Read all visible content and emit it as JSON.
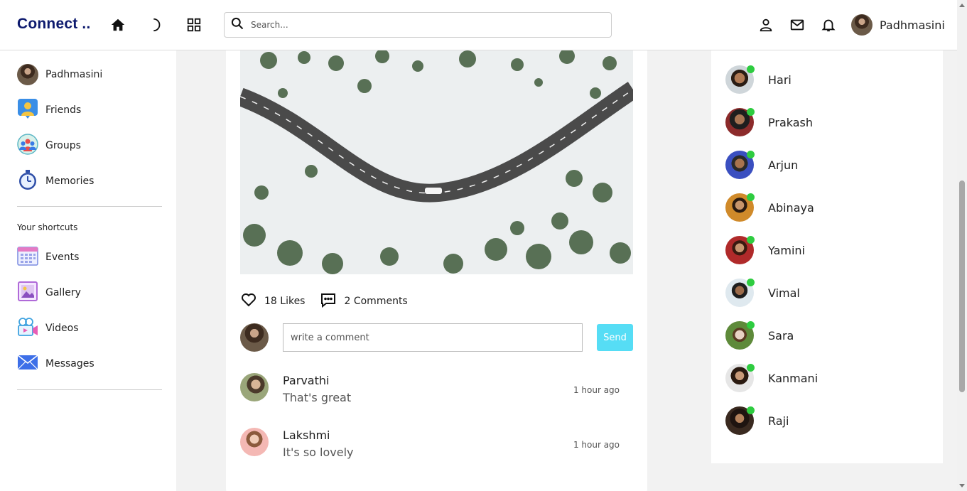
{
  "app": {
    "title": "Connect .."
  },
  "navbar": {
    "icons": [
      "home-icon",
      "moon-icon",
      "grid-icon"
    ],
    "search_placeholder": "Search...",
    "right_icons": [
      "person-icon",
      "mail-icon",
      "bell-icon"
    ],
    "user_name": "Padhmasini"
  },
  "sidebar": {
    "items": [
      {
        "label": "Padhmasini",
        "icon": "avatar"
      },
      {
        "label": "Friends",
        "icon": "friends-icon"
      },
      {
        "label": "Groups",
        "icon": "groups-icon"
      },
      {
        "label": "Memories",
        "icon": "stopwatch-icon"
      }
    ],
    "shortcuts_title": "Your shortcuts",
    "shortcuts": [
      {
        "label": "Events",
        "icon": "calendar-icon"
      },
      {
        "label": "Gallery",
        "icon": "gallery-icon"
      },
      {
        "label": "Videos",
        "icon": "video-icon"
      },
      {
        "label": "Messages",
        "icon": "envelope-icon"
      }
    ]
  },
  "post": {
    "likes": "18 Likes",
    "comments_count": "2 Comments",
    "comment_placeholder": "write a comment",
    "send_label": "Send",
    "comments": [
      {
        "name": "Parvathi",
        "text": "That's great",
        "time": "1 hour ago"
      },
      {
        "name": "Lakshmi",
        "text": "It's so lovely",
        "time": "1 hour ago"
      }
    ]
  },
  "online": {
    "friends": [
      "Hari",
      "Prakash",
      "Arjun",
      "Abinaya",
      "Yamini",
      "Vimal",
      "Sara",
      "Kanmani",
      "Raji"
    ],
    "status_color": "#2ecc40"
  },
  "colors": {
    "brand": "#0d1a6e",
    "send_button": "#56ddf5"
  }
}
